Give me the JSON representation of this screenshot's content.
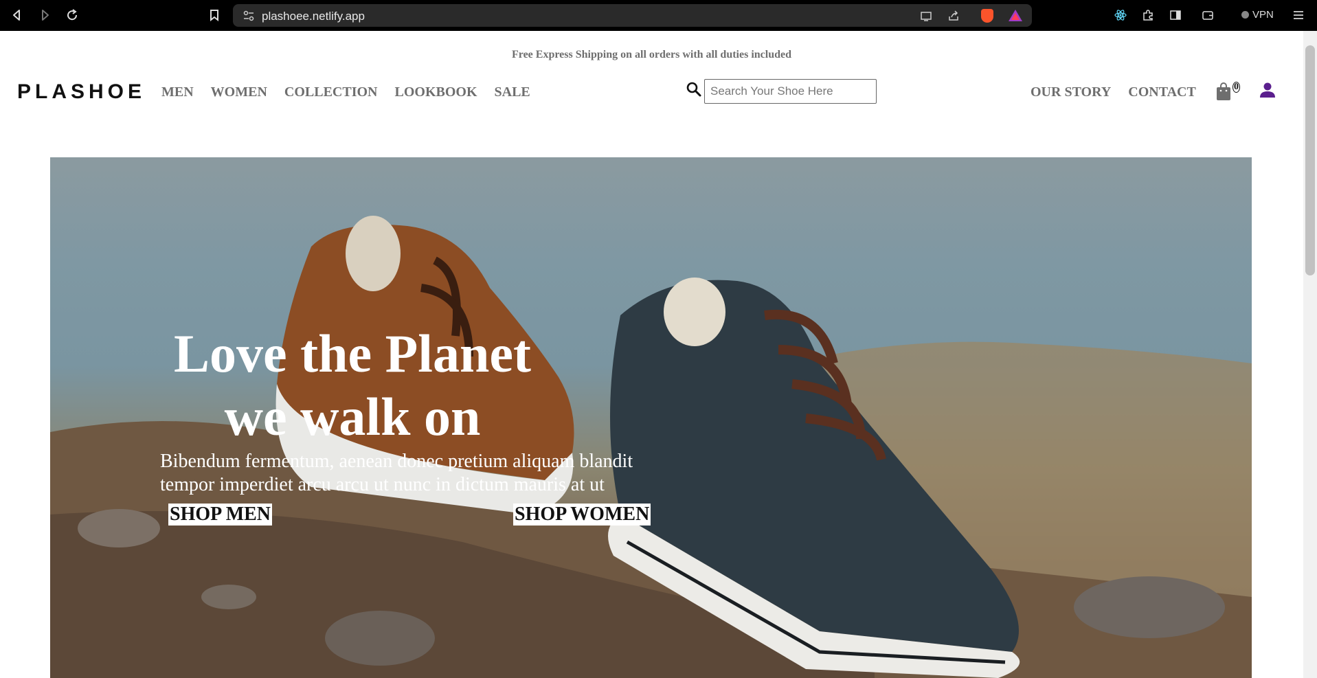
{
  "browser": {
    "url": "plashoee.netlify.app",
    "vpn_label": "VPN",
    "icons": [
      "back-icon",
      "forward-icon",
      "reload-icon",
      "bookmark-icon",
      "site-settings-icon",
      "cast-icon",
      "share-icon",
      "brave-shields-icon",
      "brave-rewards-icon",
      "react-devtools-icon",
      "extensions-icon",
      "sidebar-icon",
      "wallet-icon",
      "menu-icon"
    ]
  },
  "announcement": "Free Express Shipping on all orders with all duties included",
  "header": {
    "logo": "PLASHOE",
    "nav_left": [
      "MEN",
      "WOMEN",
      "COLLECTION",
      "LOOKBOOK",
      "SALE"
    ],
    "search_placeholder": "Search Your Shoe Here",
    "nav_right": [
      "OUR STORY",
      "CONTACT"
    ],
    "cart_count": "0",
    "user_icon_color": "#5b1f8e"
  },
  "hero": {
    "title_line1": "Love the Planet",
    "title_line2": "we walk on",
    "text_line1": "Bibendum fermentum, aenean donec pretium aliquam blandit",
    "text_line2": "tempor imperdiet arcu arcu ut nunc in dictum mauris at ut",
    "button_men": "SHOP MEN",
    "button_women": "SHOP WOMEN"
  }
}
